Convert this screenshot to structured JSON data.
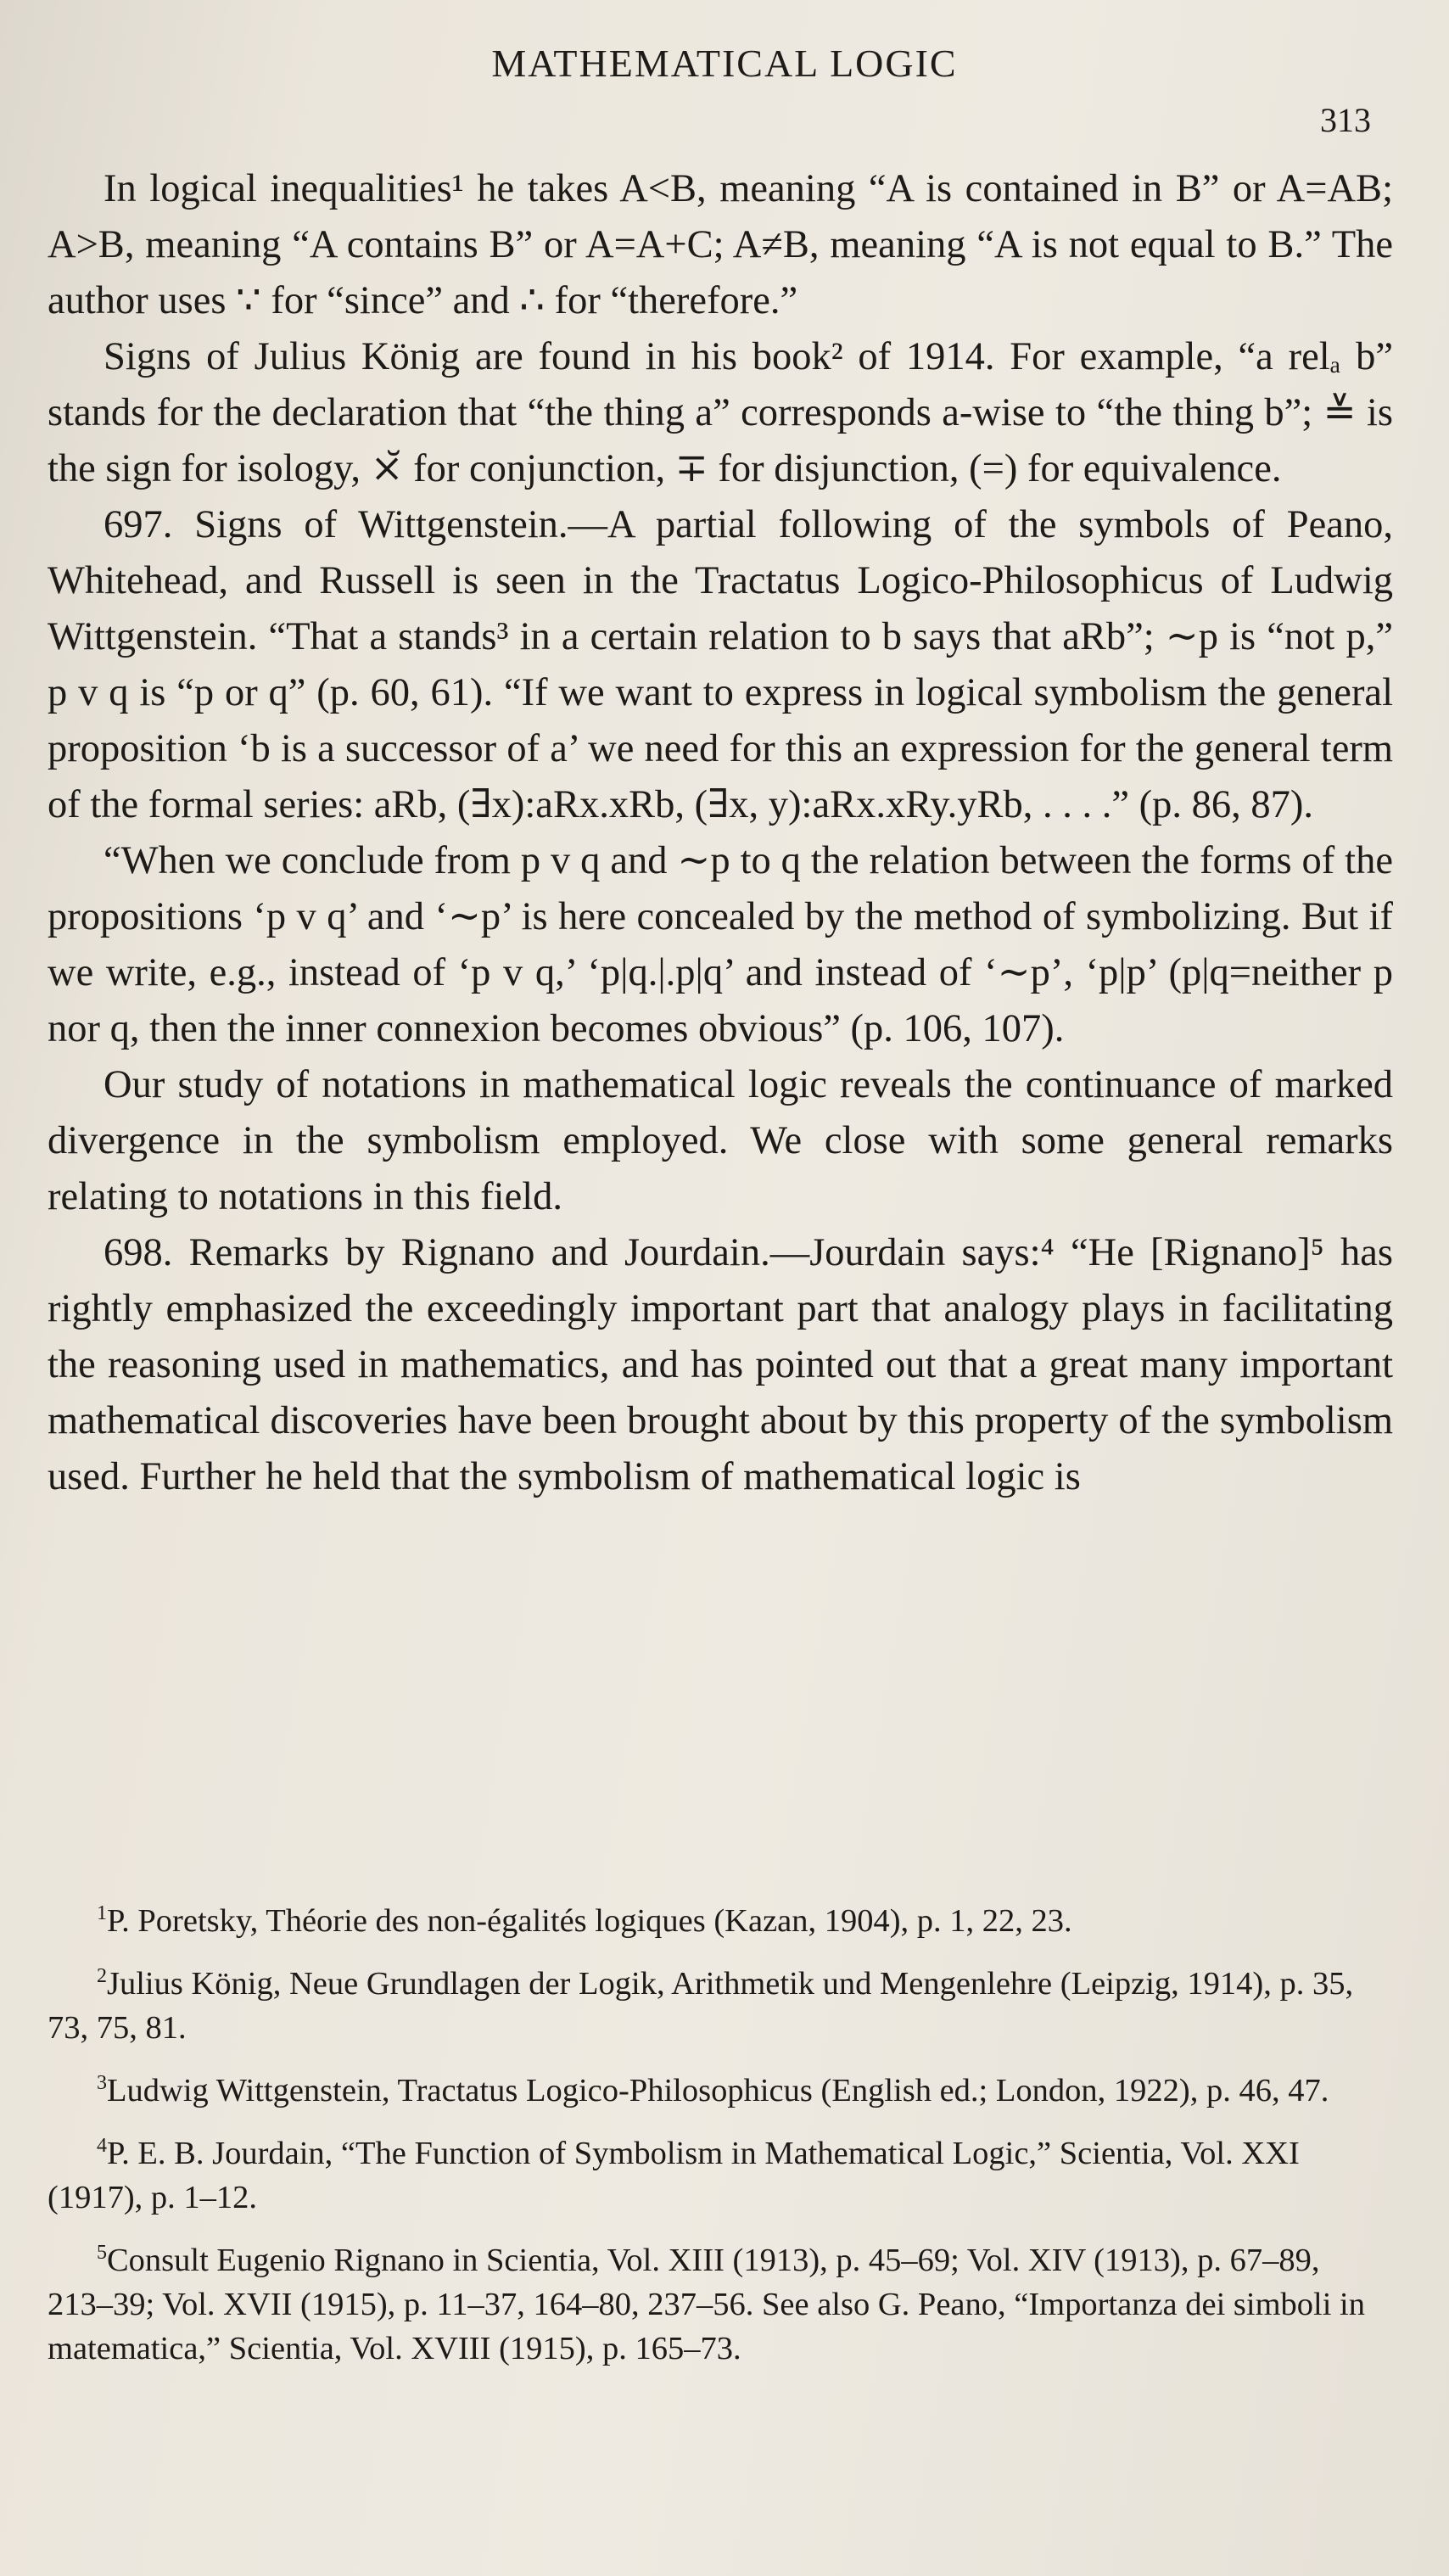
{
  "header": {
    "running_title": "MATHEMATICAL LOGIC",
    "page_number": "313"
  },
  "body": {
    "paragraphs": [
      "In logical inequalities¹ he takes A<B, meaning “A is contained in B” or A=AB; A>B, meaning “A contains B” or A=A+C; A≠B, meaning “A is not equal to B.” The author uses ∵ for “since” and ∴ for “therefore.”",
      "Signs of Julius König are found in his book² of 1914. For example, “a relₐ b” stands for the declaration that “the thing a” corresponds a-wise to “the thing b”; ≚ is the sign for isology, ⨯̆ for conjunction, ∓ for disjunction, (=) for equivalence.",
      "697. Signs of Wittgenstein.—A partial following of the symbols of Peano, Whitehead, and Russell is seen in the Tractatus Logico-Philosophicus of Ludwig Wittgenstein. “That a stands³ in a certain relation to b says that aRb”; ∼p is “not p,” p v q is “p or q” (p. 60, 61). “If we want to express in logical symbolism the general proposition ‘b is a successor of a’ we need for this an expression for the general term of the formal series: aRb, (∃x):aRx.xRb, (∃x, y):aRx.xRy.yRb, . . . .” (p. 86, 87).",
      "“When we conclude from p v q and ∼p to q the relation between the forms of the propositions ‘p v q’ and ‘∼p’ is here concealed by the method of symbolizing. But if we write, e.g., instead of ‘p v q,’ ‘p|q.|.p|q’ and instead of ‘∼p’, ‘p|p’ (p|q=neither p nor q, then the inner connexion becomes obvious” (p. 106, 107).",
      "Our study of notations in mathematical logic reveals the continuance of marked divergence in the symbolism employed. We close with some general remarks relating to notations in this field.",
      "698. Remarks by Rignano and Jourdain.—Jourdain says:⁴ “He [Rignano]⁵ has rightly emphasized the exceedingly important part that analogy plays in facilitating the reasoning used in mathematics, and has pointed out that a great many important mathematical discoveries have been brought about by this property of the symbolism used. Further he held that the symbolism of mathematical logic is"
    ]
  },
  "footnotes": [
    {
      "mark": "1",
      "text": "P. Poretsky, Théorie des non-égalités logiques (Kazan, 1904), p. 1, 22, 23."
    },
    {
      "mark": "2",
      "text": "Julius König, Neue Grundlagen der Logik, Arithmetik und Mengenlehre (Leipzig, 1914), p. 35, 73, 75, 81."
    },
    {
      "mark": "3",
      "text": "Ludwig Wittgenstein, Tractatus Logico-Philosophicus (English ed.; London, 1922), p. 46, 47."
    },
    {
      "mark": "4",
      "text": "P. E. B. Jourdain, “The Function of Symbolism in Mathematical Logic,” Scientia, Vol. XXI (1917), p. 1–12."
    },
    {
      "mark": "5",
      "text": "Consult Eugenio Rignano in Scientia, Vol. XIII (1913), p. 45–69; Vol. XIV (1913), p. 67–89, 213–39; Vol. XVII (1915), p. 11–37, 164–80, 237–56. See also G. Peano, “Importanza dei simboli in matematica,” Scientia, Vol. XVIII (1915), p. 165–73."
    }
  ]
}
